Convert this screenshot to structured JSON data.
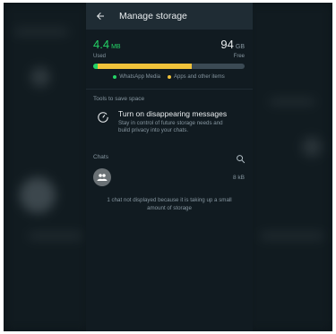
{
  "appbar": {
    "title": "Manage storage"
  },
  "storage": {
    "used_value": "4.4",
    "used_unit": "MB",
    "used_label": "Used",
    "free_value": "94",
    "free_unit": "GB",
    "free_label": "Free",
    "whatsapp_fraction": 0.03,
    "apps_fraction": 0.62,
    "legend": [
      {
        "label": "WhatsApp Media",
        "color": "#24d366"
      },
      {
        "label": "Apps and other items",
        "color": "#f0c23a"
      }
    ]
  },
  "tools": {
    "section_title": "Tools to save space",
    "items": [
      {
        "title": "Turn on disappearing messages",
        "description": "Stay in control of future storage needs and build privacy into your chats.",
        "icon": "timer-icon"
      }
    ]
  },
  "chats": {
    "section_title": "Chats",
    "items": [
      {
        "avatar": "group-icon",
        "size": "8 kB"
      }
    ],
    "hidden_note": "1 chat not displayed because it is taking up a small amount of storage"
  },
  "colors": {
    "accent": "#24d366",
    "apps": "#f0c23a",
    "background": "#111b21",
    "appbar": "#1f2c34"
  }
}
